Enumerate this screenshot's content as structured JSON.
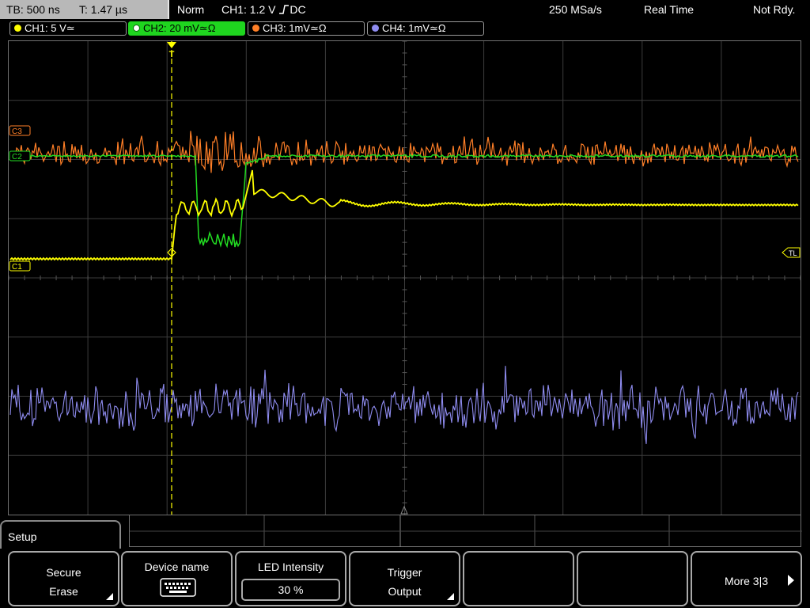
{
  "status_bar": {
    "timebase": "TB: 500 ns",
    "trigger_time": "T: 1.47 µs",
    "mode": "Norm",
    "trigger_source": "CH1: 1.2 V",
    "trigger_edge_icon": "rising-edge-icon",
    "trigger_coupling": "DC",
    "sample_rate": "250 MSa/s",
    "acquisition": "Real Time",
    "state": "Not Rdy."
  },
  "channels": [
    {
      "label": "CH1: 5 V≃",
      "color": "#ffff00",
      "active": false
    },
    {
      "label": "CH2: 20 mV≃Ω",
      "color": "#22dd22",
      "active": true
    },
    {
      "label": "CH3: 1mV≃Ω",
      "color": "#ff7f27",
      "active": false
    },
    {
      "label": "CH4: 1mV≃Ω",
      "color": "#8f8cf0",
      "active": false
    }
  ],
  "screen": {
    "markers": {
      "ch3": "C3",
      "ch1": "C1",
      "ch2": "C2",
      "trigger_level": "TL",
      "trigger_pos": "T"
    },
    "grid_color": "#3c3c3c",
    "trace_colors": {
      "ch1": "#ffff00",
      "ch2": "#22dd22",
      "ch3": "#ff7f27",
      "ch4": "#8f8cf0"
    }
  },
  "menu": {
    "title": "Setup",
    "softkeys": [
      {
        "line1": "Secure",
        "line2": "Erase"
      },
      {
        "line1": "Device name",
        "icon": "keyboard-icon"
      },
      {
        "line1": "LED Intensity",
        "value": "30 %"
      },
      {
        "line1": "Trigger",
        "line2": "Output"
      },
      {
        "line1": ""
      },
      {
        "line1": ""
      },
      {
        "line1": "More 3|3",
        "icon": "next-page-icon"
      }
    ]
  }
}
